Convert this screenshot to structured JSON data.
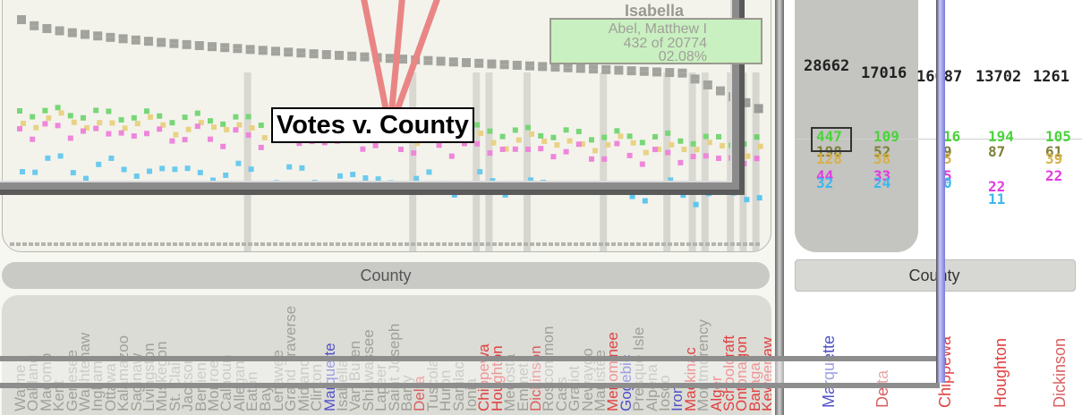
{
  "plot": {
    "axis_title": "County",
    "tooltip_label": "Votes v. County",
    "hover_box": {
      "county": "Isabella",
      "candidate": "Abel, Matthew I",
      "votes_line": "432 of 20774",
      "percent": "02.08%"
    },
    "series_colors": {
      "gray_totals": "#9a9a96",
      "green": "#6ad36a",
      "yellow": "#e8cf7a",
      "pink": "#ee7ad8",
      "cyan": "#5cc6ee",
      "red_lines": "#e87a7a"
    },
    "left_counties": [
      {
        "name": "Wayne",
        "color": "#a0a09a"
      },
      {
        "name": "Oakland",
        "color": "#a0a09a"
      },
      {
        "name": "Macomb",
        "color": "#a0a09a"
      },
      {
        "name": "Kent",
        "color": "#a0a09a"
      },
      {
        "name": "Genesee",
        "color": "#a0a09a"
      },
      {
        "name": "Washtenaw",
        "color": "#a0a09a"
      },
      {
        "name": "Ingham",
        "color": "#a0a09a"
      },
      {
        "name": "Ottawa",
        "color": "#a0a09a"
      },
      {
        "name": "Kalamazoo",
        "color": "#a0a09a"
      },
      {
        "name": "Saginaw",
        "color": "#a0a09a"
      },
      {
        "name": "Livingston",
        "color": "#a0a09a"
      },
      {
        "name": "Muskegon",
        "color": "#a0a09a"
      },
      {
        "name": "St. Clair",
        "color": "#a0a09a"
      },
      {
        "name": "Jackson",
        "color": "#a0a09a"
      },
      {
        "name": "Berrien",
        "color": "#a0a09a"
      },
      {
        "name": "Monroe",
        "color": "#a0a09a"
      },
      {
        "name": "Calhoun",
        "color": "#a0a09a"
      },
      {
        "name": "Allegan",
        "color": "#a0a09a"
      },
      {
        "name": "Eaton",
        "color": "#a0a09a"
      },
      {
        "name": "Bay",
        "color": "#a0a09a"
      },
      {
        "name": "Lenawee",
        "color": "#a0a09a"
      },
      {
        "name": "Grand Traverse",
        "color": "#a0a09a"
      },
      {
        "name": "Midland",
        "color": "#a0a09a"
      },
      {
        "name": "Clinton",
        "color": "#a0a09a"
      },
      {
        "name": "Marquette",
        "color": "#5050c8"
      },
      {
        "name": "Isabella",
        "color": "#a0a09a"
      },
      {
        "name": "Van Buren",
        "color": "#a0a09a"
      },
      {
        "name": "Shiawassee",
        "color": "#a0a09a"
      },
      {
        "name": "Lapeer",
        "color": "#a0a09a"
      },
      {
        "name": "Saint Joseph",
        "color": "#a0a09a"
      },
      {
        "name": "Barry",
        "color": "#a0a09a"
      },
      {
        "name": "Delta",
        "color": "#d86060"
      },
      {
        "name": "Tuscola",
        "color": "#a0a09a"
      },
      {
        "name": "Huron",
        "color": "#a0a09a"
      },
      {
        "name": "Sanilac",
        "color": "#a0a09a"
      },
      {
        "name": "Ionia",
        "color": "#a0a09a"
      },
      {
        "name": "Chippewa",
        "color": "#e04040"
      },
      {
        "name": "Houghton",
        "color": "#e04040"
      },
      {
        "name": "Mecosta",
        "color": "#a0a09a"
      },
      {
        "name": "Emmet",
        "color": "#a0a09a"
      },
      {
        "name": "Dickinson",
        "color": "#d86060"
      },
      {
        "name": "Roscommon",
        "color": "#a0a09a"
      },
      {
        "name": "Cass",
        "color": "#a0a09a"
      },
      {
        "name": "Gratiot",
        "color": "#a0a09a"
      },
      {
        "name": "Newaygo",
        "color": "#a0a09a"
      },
      {
        "name": "Manistee",
        "color": "#a0a09a"
      },
      {
        "name": "Menominee",
        "color": "#e04040"
      },
      {
        "name": "Gogebic",
        "color": "#5050c8"
      },
      {
        "name": "Presque Isle",
        "color": "#a0a09a"
      },
      {
        "name": "Alpena",
        "color": "#a0a09a"
      },
      {
        "name": "Iosco",
        "color": "#a0a09a"
      },
      {
        "name": "Iron",
        "color": "#5050c8"
      },
      {
        "name": "Mackinac",
        "color": "#e04040"
      },
      {
        "name": "Montmorency",
        "color": "#a0a09a"
      },
      {
        "name": "Alger",
        "color": "#e04040"
      },
      {
        "name": "Schoolcraft",
        "color": "#e04040"
      },
      {
        "name": "Ontonagon",
        "color": "#e04040"
      },
      {
        "name": "Baraga",
        "color": "#e04040"
      },
      {
        "name": "Keweenaw",
        "color": "#e04040"
      }
    ]
  },
  "right": {
    "totals": [
      "28662",
      "17016",
      "16087",
      "13702",
      "1261"
    ],
    "axis_title": "County",
    "counties": [
      {
        "name": "Marquette",
        "color": "#5050c8"
      },
      {
        "name": "Delta",
        "color": "#d86060"
      },
      {
        "name": "Chippewa",
        "color": "#e04040"
      },
      {
        "name": "Houghton",
        "color": "#e04040"
      },
      {
        "name": "Dickinson",
        "color": "#d86060"
      }
    ],
    "columns": [
      {
        "green": "447",
        "olive": "198",
        "gold": "128",
        "purple": "44",
        "blue": "32"
      },
      {
        "green": "109",
        "olive": "52",
        "gold": "38",
        "purple": "33",
        "blue": "24"
      },
      {
        "green": "16",
        "olive": "9",
        "gold": "5",
        "purple": "5",
        "blue": "0"
      },
      {
        "green": "194",
        "olive": "87",
        "gold": "",
        "purple": "22",
        "blue": "11"
      },
      {
        "green": "105",
        "olive": "61",
        "gold": "39",
        "purple": "22",
        "blue": ""
      }
    ]
  }
}
